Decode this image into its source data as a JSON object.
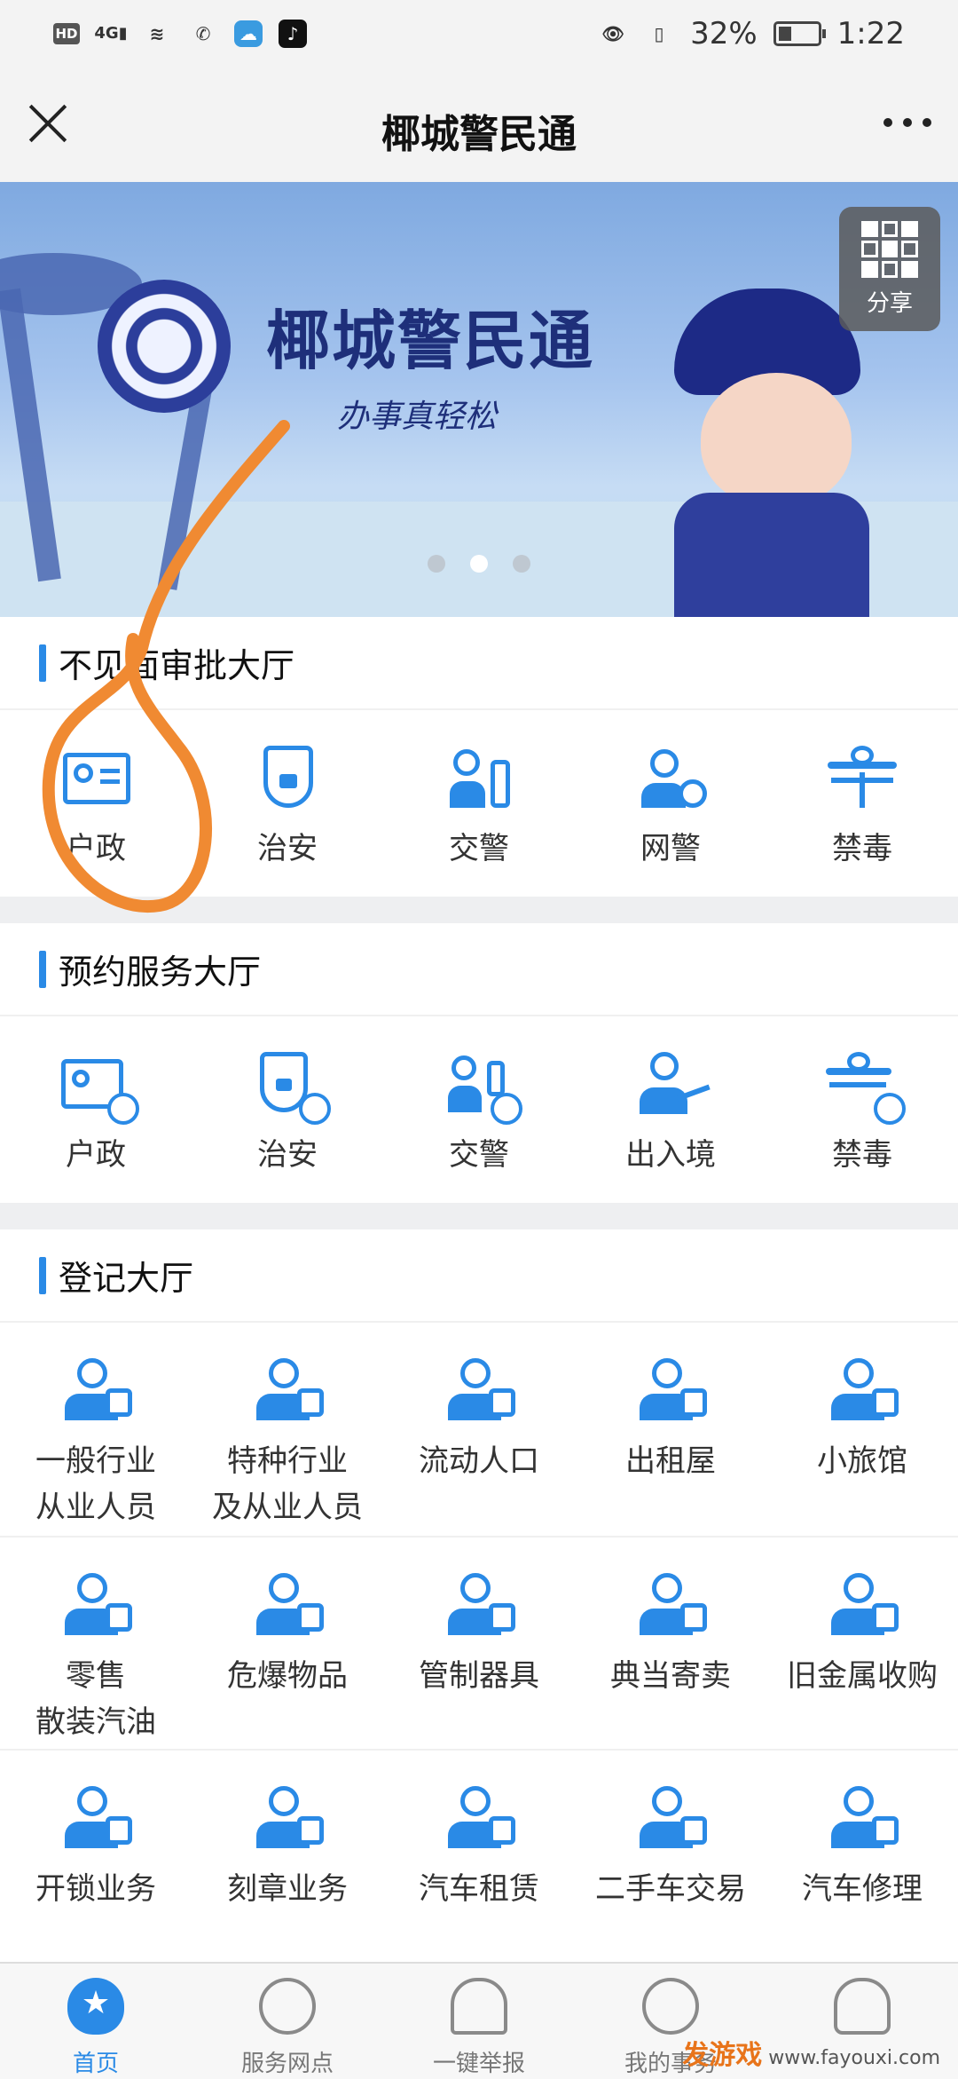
{
  "status": {
    "net": "4G",
    "battery": "32%",
    "time": "1:22"
  },
  "header": {
    "title": "椰城警民通"
  },
  "banner": {
    "title": "椰城警民通",
    "slogan": "办事真轻松",
    "share_label": "分享",
    "dots": 3,
    "active_dot": 1
  },
  "sections": [
    {
      "title": "不见面审批大厅",
      "items": [
        {
          "label": "户政",
          "icon": "id-card-icon"
        },
        {
          "label": "治安",
          "icon": "shield-lock-icon"
        },
        {
          "label": "交警",
          "icon": "traffic-police-icon"
        },
        {
          "label": "网警",
          "icon": "cyber-police-icon"
        },
        {
          "label": "禁毒",
          "icon": "anti-drug-icon"
        }
      ]
    },
    {
      "title": "预约服务大厅",
      "items": [
        {
          "label": "户政",
          "icon": "id-card-clock-icon"
        },
        {
          "label": "治安",
          "icon": "shield-clock-icon"
        },
        {
          "label": "交警",
          "icon": "traffic-police-clock-icon"
        },
        {
          "label": "出入境",
          "icon": "airplane-officer-icon"
        },
        {
          "label": "禁毒",
          "icon": "anti-drug-clock-icon"
        }
      ]
    },
    {
      "title": "登记大厅",
      "items": [
        {
          "label": "一般行业\n从业人员",
          "icon": "worker-briefcase-icon"
        },
        {
          "label": "特种行业\n及从业人员",
          "icon": "special-worker-icon"
        },
        {
          "label": "流动人口",
          "icon": "mobile-population-icon"
        },
        {
          "label": "出租屋",
          "icon": "rental-house-icon"
        },
        {
          "label": "小旅馆",
          "icon": "hotel-building-icon"
        },
        {
          "label": "零售\n散装汽油",
          "icon": "gas-pump-icon"
        },
        {
          "label": "危爆物品",
          "icon": "skull-icon"
        },
        {
          "label": "管制器具",
          "icon": "controlled-tool-icon"
        },
        {
          "label": "典当寄卖",
          "icon": "pawn-icon"
        },
        {
          "label": "旧金属收购",
          "icon": "scrap-metal-icon"
        },
        {
          "label": "开锁业务",
          "icon": "lock-clipboard-icon"
        },
        {
          "label": "刻章业务",
          "icon": "stamp-icon"
        },
        {
          "label": "汽车租赁",
          "icon": "car-rental-icon"
        },
        {
          "label": "二手车交易",
          "icon": "used-car-icon"
        },
        {
          "label": "汽车修理",
          "icon": "car-repair-icon"
        }
      ]
    }
  ],
  "tabs": [
    {
      "label": "首页",
      "icon": "home-shield-icon",
      "active": true
    },
    {
      "label": "服务网点",
      "icon": "globe-icon",
      "active": false
    },
    {
      "label": "一键举报",
      "icon": "alarm-icon",
      "active": false
    },
    {
      "label": "我的事务",
      "icon": "compass-icon",
      "active": false
    },
    {
      "label": "",
      "icon": "user-icon",
      "active": false
    }
  ],
  "watermark": {
    "brand": "发游戏",
    "site": "www.fayouxi.com"
  },
  "accent": "#2a8ae6"
}
